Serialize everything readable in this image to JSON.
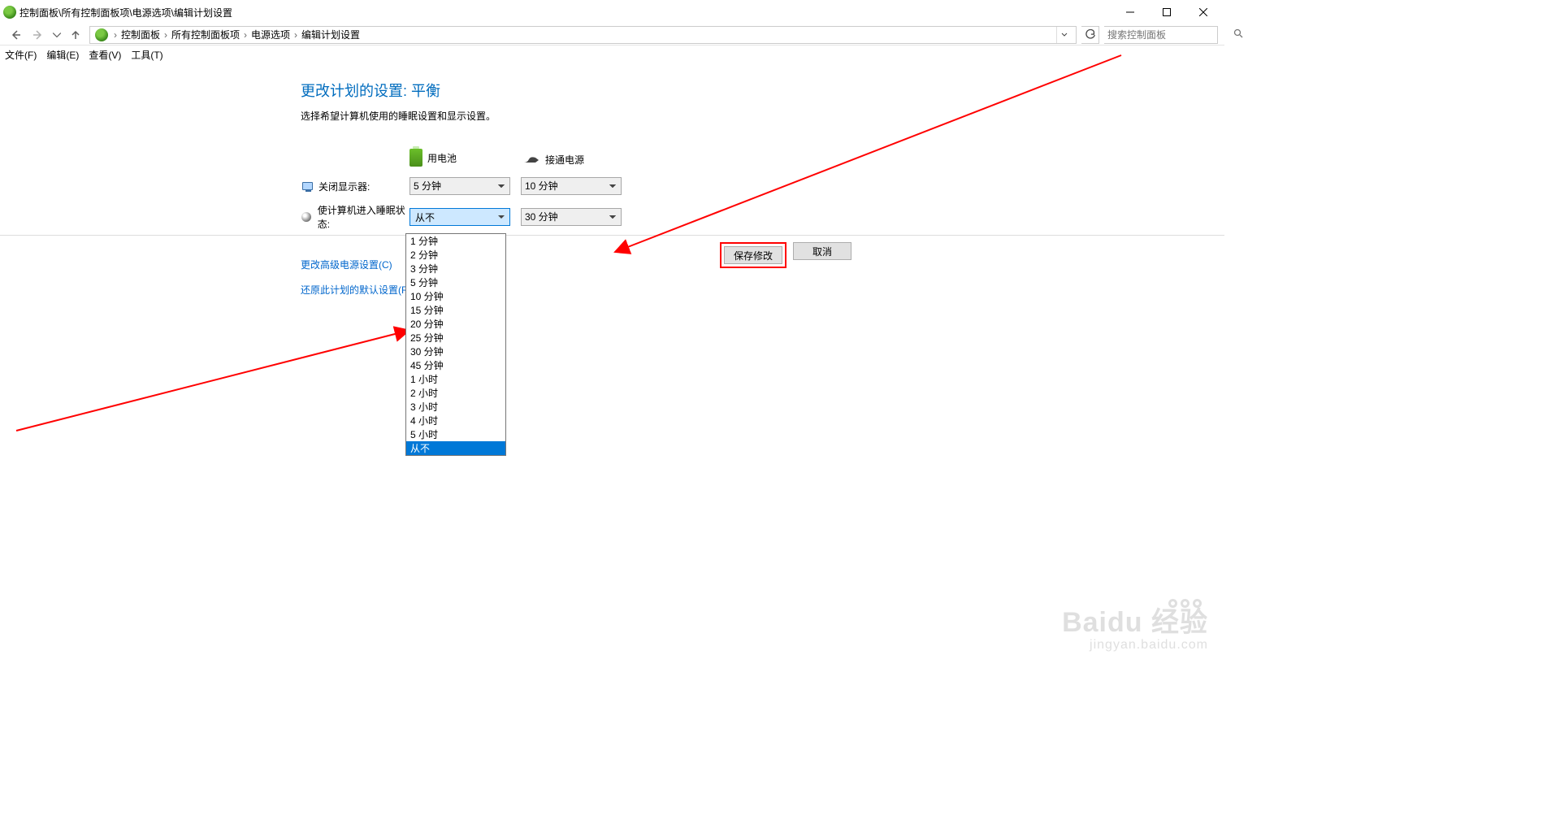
{
  "titlebar": {
    "title": "控制面板\\所有控制面板项\\电源选项\\编辑计划设置"
  },
  "breadcrumbs": {
    "items": [
      "控制面板",
      "所有控制面板项",
      "电源选项",
      "编辑计划设置"
    ]
  },
  "search": {
    "placeholder": "搜索控制面板"
  },
  "menus": {
    "file": "文件(F)",
    "edit": "编辑(E)",
    "view": "查看(V)",
    "tools": "工具(T)"
  },
  "main": {
    "heading": "更改计划的设置: 平衡",
    "subtext": "选择希望计算机使用的睡眠设置和显示设置。",
    "col_battery": "用电池",
    "col_plugged": "接通电源",
    "row_display_label": "关闭显示器:",
    "row_sleep_label": "使计算机进入睡眠状态:",
    "display_battery_value": "5 分钟",
    "display_plugged_value": "10 分钟",
    "sleep_battery_value": "从不",
    "sleep_plugged_value": "30 分钟",
    "link_advanced": "更改高级电源设置(C)",
    "link_restore": "还原此计划的默认设置(R)"
  },
  "dropdown_options": [
    "1 分钟",
    "2 分钟",
    "3 分钟",
    "5 分钟",
    "10 分钟",
    "15 分钟",
    "20 分钟",
    "25 分钟",
    "30 分钟",
    "45 分钟",
    "1 小时",
    "2 小时",
    "3 小时",
    "4 小时",
    "5 小时",
    "从不"
  ],
  "dropdown_selected": "从不",
  "buttons": {
    "save": "保存修改",
    "cancel": "取消"
  },
  "watermark": {
    "brand": "Baidu 经验",
    "sub": "jingyan.baidu.com"
  }
}
